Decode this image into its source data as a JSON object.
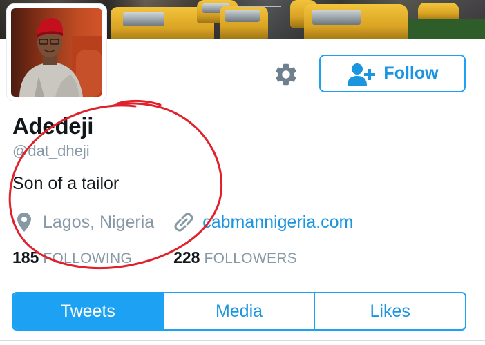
{
  "profile": {
    "name": "Adedeji",
    "handle": "@dat_dheji",
    "bio": "Son of a tailor",
    "location": "Lagos, Nigeria",
    "website": "cabmannigeria.com"
  },
  "actions": {
    "follow_label": "Follow",
    "settings_icon": "gear-icon",
    "follow_icon": "add-user-icon"
  },
  "stats": {
    "following_count": "185",
    "following_label": "FOLLOWING",
    "followers_count": "228",
    "followers_label": "FOLLOWERS"
  },
  "tabs": [
    {
      "label": "Tweets",
      "active": true
    },
    {
      "label": "Media",
      "active": false
    },
    {
      "label": "Likes",
      "active": false
    }
  ],
  "colors": {
    "accent": "#1da1f2",
    "link": "#1b95e0",
    "muted": "#8899a6",
    "text": "#14171a",
    "annotation": "#e0202a"
  },
  "icons": {
    "location": "location-pin-icon",
    "link": "link-icon"
  }
}
